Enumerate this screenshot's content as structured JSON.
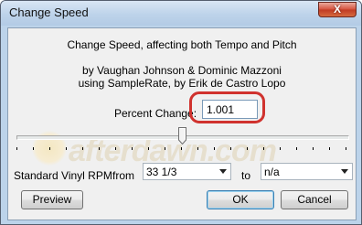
{
  "window": {
    "title": "Change Speed",
    "close_label": "X"
  },
  "dialog": {
    "heading": "Change Speed, affecting both Tempo and Pitch",
    "credits_line1": "by Vaughan Johnson & Dominic Mazzoni",
    "credits_line2": "using SampleRate, by Erik de Castro Lopo",
    "percent_label": "Percent Change:",
    "percent_value": "1.001",
    "slider": {
      "position_fraction": 0.5
    },
    "rpm_label": "Standard Vinyl RPM:",
    "from_label": "from",
    "from_value": "33 1/3",
    "to_label": "to",
    "to_value": "n/a",
    "watermark": "afterdawn.com"
  },
  "buttons": {
    "preview": "Preview",
    "ok": "OK",
    "cancel": "Cancel"
  },
  "colors": {
    "highlight_ring": "#d0322e",
    "close_button": "#c03b23"
  }
}
